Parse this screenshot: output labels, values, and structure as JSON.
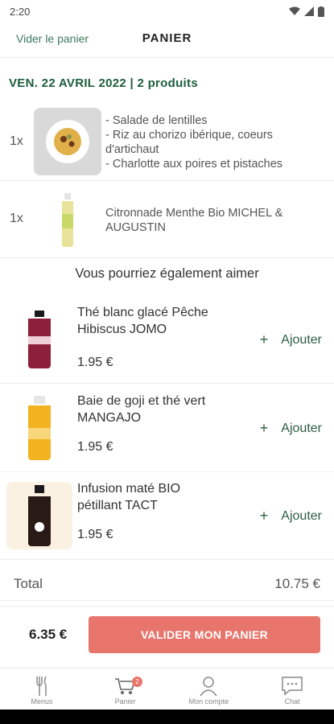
{
  "status_bar": {
    "time": "2:20"
  },
  "header": {
    "empty_cart": "Vider le panier",
    "title": "PANIER"
  },
  "order": {
    "date_line": "VEN. 22 AVRIL 2022  | 2 produits"
  },
  "cart_items": [
    {
      "qty": "1x",
      "lines": [
        "- Salade de lentilles",
        "- Riz au chorizo ibérique, coeurs d'artichaut",
        "- Charlotte aux poires et pistaches"
      ]
    },
    {
      "qty": "1x",
      "lines": [
        "Citronnade Menthe Bio MICHEL & AUGUSTIN"
      ]
    }
  ],
  "suggestions": {
    "title": "Vous pourriez également aimer",
    "items": [
      {
        "name": "Thé blanc glacé Pêche Hibiscus JOMO",
        "price": "1.95 €",
        "add_label": "Ajouter",
        "color": "#8e1f3a"
      },
      {
        "name": "Baie de goji et thé vert MANGAJO",
        "price": "1.95 €",
        "add_label": "Ajouter",
        "color": "#f2b320"
      },
      {
        "name": "Infusion maté BIO pétillant TACT",
        "price": "1.95 €",
        "add_label": "Ajouter",
        "color": "#2a1a16"
      }
    ]
  },
  "total": {
    "label": "Total",
    "value": "10.75 €"
  },
  "footer": {
    "amount": "6.35 €",
    "validate_label": "VALIDER MON PANIER"
  },
  "nav": {
    "items": [
      {
        "label": "Menus",
        "icon": "fork-knife-icon"
      },
      {
        "label": "Panier",
        "icon": "cart-icon",
        "badge": "2"
      },
      {
        "label": "Mon compte",
        "icon": "user-icon"
      },
      {
        "label": "Chat",
        "icon": "chat-icon"
      }
    ]
  },
  "colors": {
    "accent": "#e8756b",
    "green": "#1d5e3a",
    "link": "#3d7a5c"
  }
}
